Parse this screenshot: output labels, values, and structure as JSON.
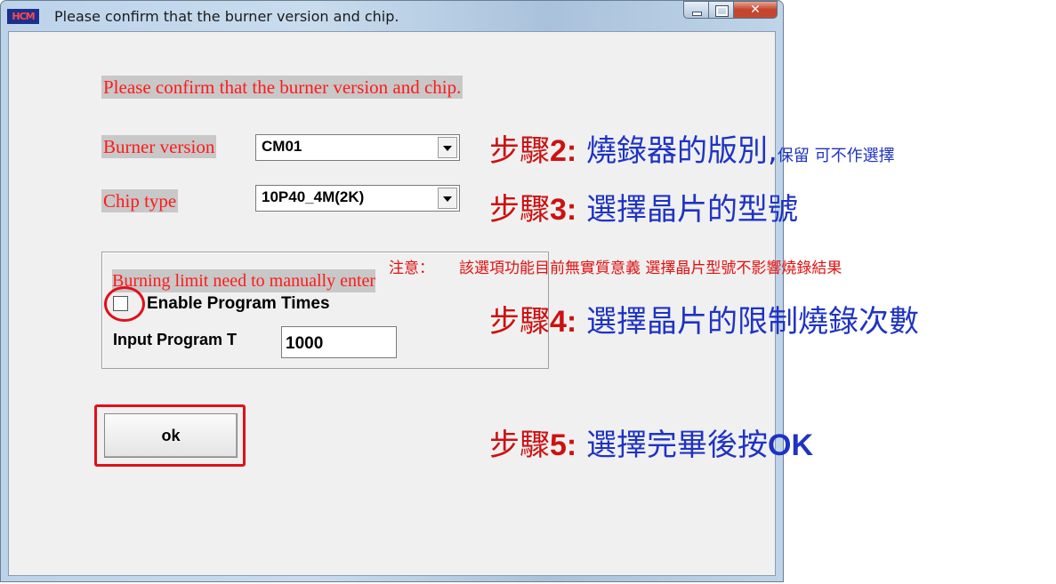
{
  "window": {
    "title": "Please confirm that the burner version and chip.",
    "icon_text": "HCM",
    "close_glyph": "✕"
  },
  "dialog": {
    "header_label": "Please confirm that the burner version and chip.",
    "burner_label": "Burner version",
    "burner_value": "CM01",
    "chip_label": "Chip type",
    "chip_value": "10P40_4M(2K)",
    "group_label": "Burning limit need to manually enter",
    "checkbox_label": "Enable Program Times",
    "checkbox_checked": false,
    "input_label": "Input Program T",
    "input_value": "1000",
    "ok_label": "ok"
  },
  "annotations": {
    "step2": {
      "prefix": "步驟",
      "num": "2:",
      "text": " 燒錄器的版別,",
      "small": "保留 可不作選擇"
    },
    "step3": {
      "prefix": "步驟",
      "num": "3:",
      "text": " 選擇晶片的型號"
    },
    "note": {
      "label": "注意：",
      "text": "該選項功能目前無實質意義  選擇晶片型號不影響燒錄結果"
    },
    "step4": {
      "prefix": "步驟",
      "num": "4:",
      "text": " 選擇晶片的限制燒錄次數"
    },
    "step5": {
      "prefix": "步驟",
      "num": "5:",
      "text": " 選擇完畢後按",
      "ok": "OK"
    }
  },
  "colors": {
    "annotation_red": "#e0101a",
    "annotation_blue": "#1e33c4",
    "label_red": "#ff1a1a"
  }
}
